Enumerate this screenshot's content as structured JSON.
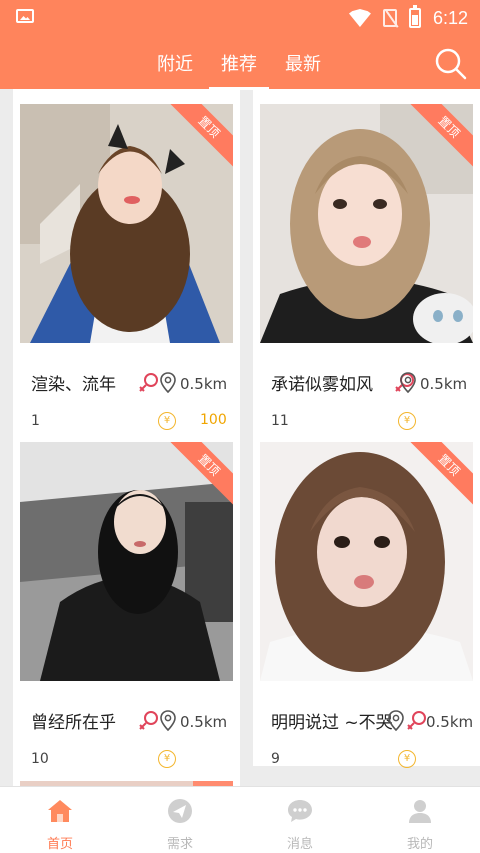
{
  "statusbar": {
    "time": "6:12"
  },
  "tabs": [
    {
      "label": "附近"
    },
    {
      "label": "推荐"
    },
    {
      "label": "最新"
    }
  ],
  "ribbon_label": "置顶",
  "cards": [
    {
      "name": "渲染、流年",
      "distance": "0.5km",
      "count": "1",
      "coins": "100",
      "coin_symbol": "¥"
    },
    {
      "name": "承诺似雾如风",
      "distance": "0.5km",
      "count": "11",
      "coins": "",
      "coin_symbol": "¥"
    },
    {
      "name": "曾经所在乎",
      "distance": "0.5km",
      "count": "10",
      "coins": "",
      "coin_symbol": "¥"
    },
    {
      "name": "明明说过 ~不哭",
      "distance": "0.5km",
      "count": "9",
      "coins": "",
      "coin_symbol": "¥"
    }
  ],
  "bottom_nav": [
    {
      "label": "首页",
      "icon": "home-icon",
      "active": true
    },
    {
      "label": "需求",
      "icon": "send-icon",
      "active": false
    },
    {
      "label": "消息",
      "icon": "chat-icon",
      "active": false
    },
    {
      "label": "我的",
      "icon": "user-icon",
      "active": false
    }
  ],
  "colors": {
    "accent": "#ff845c",
    "coin": "#f3b62e",
    "inactive": "#b8b8b8"
  }
}
